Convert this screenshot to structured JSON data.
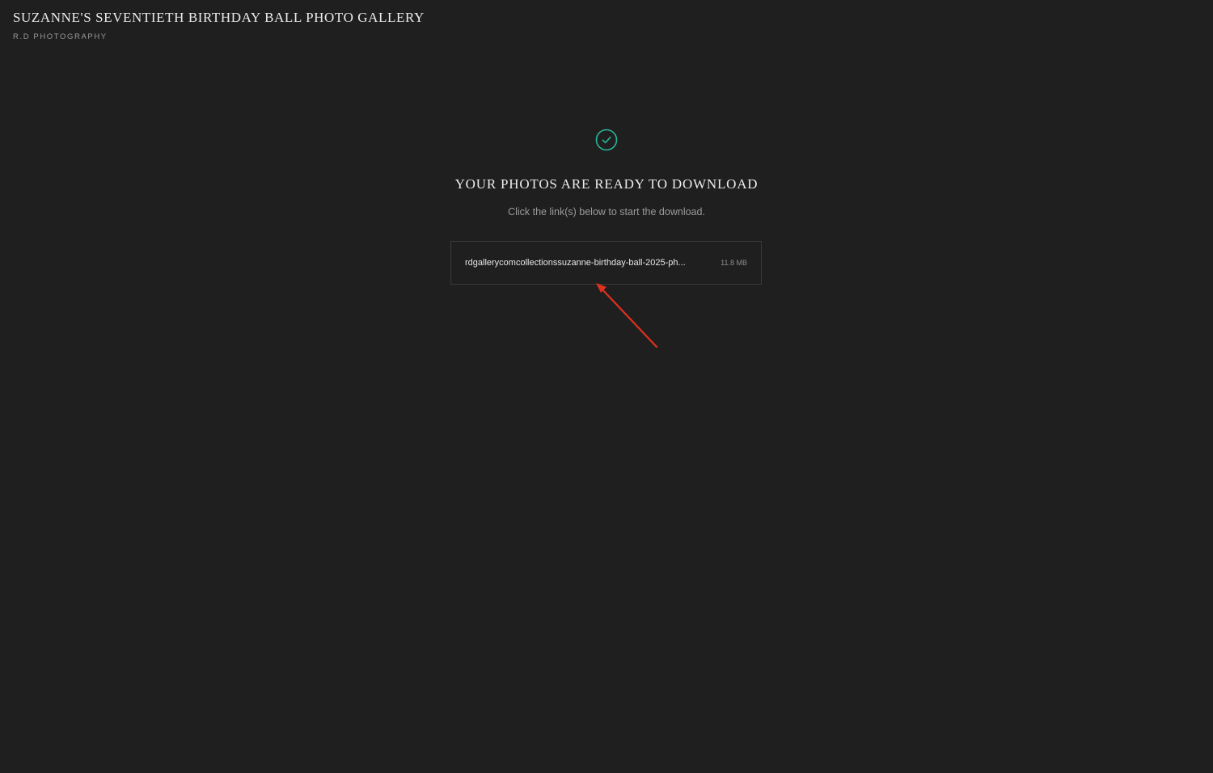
{
  "header": {
    "gallery_title": "SUZANNE'S SEVENTIETH BIRTHDAY BALL PHOTO GALLERY",
    "studio_name": "R.D PHOTOGRAPHY"
  },
  "main": {
    "status_icon": "check-circle-icon",
    "heading": "YOUR PHOTOS ARE READY TO DOWNLOAD",
    "instructions": "Click the link(s) below to start the download.",
    "downloads": [
      {
        "file_name": "rdgallerycomcollectionssuzanne-birthday-ball-2025-ph...",
        "file_size": "11.8 MB"
      }
    ]
  },
  "annotation": {
    "icon": "arrow-annotation-icon",
    "color": "#e0301e"
  },
  "colors": {
    "background": "#1f1f1f",
    "accent_check": "#2bb59a",
    "border": "#3a3a3a"
  }
}
